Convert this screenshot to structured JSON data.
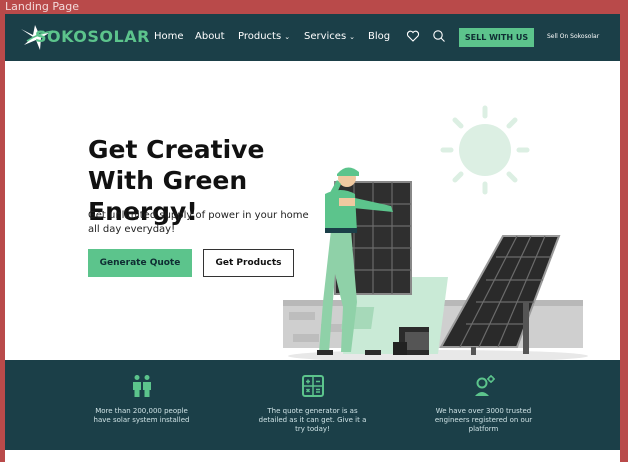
{
  "window": {
    "title": "Landing Page"
  },
  "brand": {
    "name": "SOKOSOLAR",
    "accent": "#5cc48c",
    "dark": "#1b3f48"
  },
  "nav": {
    "items": [
      {
        "label": "Home"
      },
      {
        "label": "About"
      },
      {
        "label": "Products",
        "chevron": "⌄"
      },
      {
        "label": "Services",
        "chevron": "⌄"
      },
      {
        "label": "Blog"
      }
    ],
    "icons": [
      "heart-icon",
      "search-icon"
    ],
    "sell_button": "SELL WITH US",
    "sell_link": "Sell On Sokosolar"
  },
  "hero": {
    "title": "Get Creative With Green Energy!",
    "subtitle": "Get unlimited supply of power in your home all day everyday!",
    "primary_button": "Generate Quote",
    "secondary_button": "Get Products"
  },
  "features": [
    {
      "icon": "people-icon",
      "text": "More than 200,000 people have solar system installed"
    },
    {
      "icon": "calculator-icon",
      "text": "The quote generator is as detailed as it can get. Give it a try today!"
    },
    {
      "icon": "engineer-icon",
      "text": "We have over 3000 trusted engineers registered on our platform"
    }
  ]
}
